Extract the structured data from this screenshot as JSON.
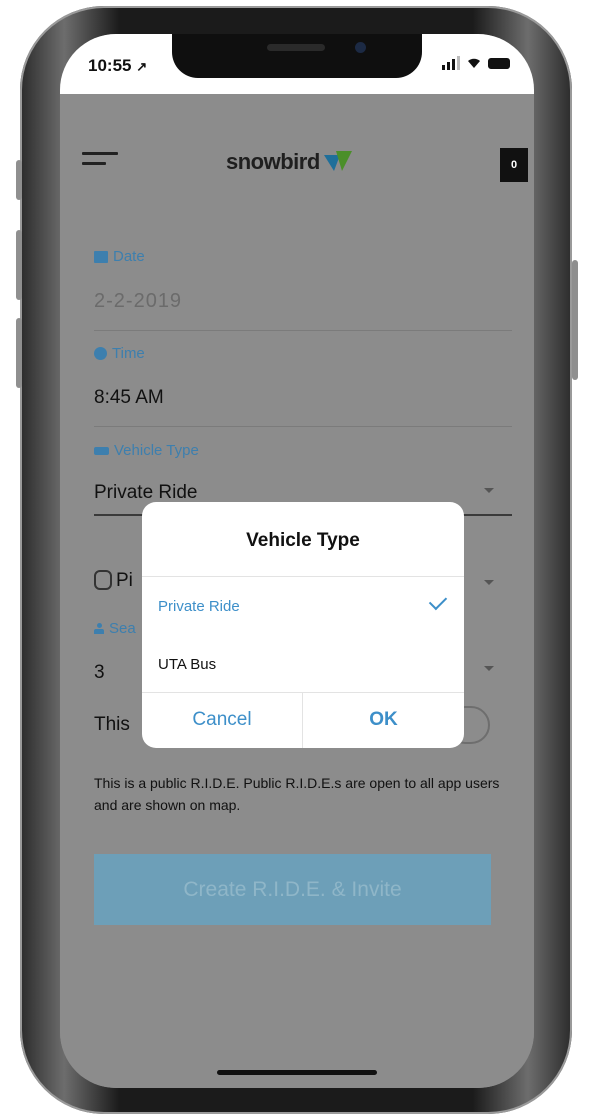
{
  "status_bar": {
    "time": "10:55",
    "location_arrow": "↗"
  },
  "header": {
    "brand": "snowbird",
    "badge_count": "0",
    "icons": [
      "menu-icon",
      "snowbird-logo-icon"
    ]
  },
  "form": {
    "date": {
      "label": "Date",
      "value": "2-2-2019"
    },
    "time": {
      "label": "Time",
      "value": "8:45 AM"
    },
    "vehicle_type": {
      "label": "Vehicle Type",
      "value": "Private Ride"
    },
    "pickup": {
      "value_partial": "Pi"
    },
    "seats": {
      "label_partial": "Sea",
      "value": "3"
    },
    "public_toggle": {
      "label_partial": "This"
    },
    "description": "This is a public R.I.D.E. Public R.I.D.E.s are open to all app users and are shown on map.",
    "submit_label": "Create R.I.D.E. & Invite"
  },
  "dialog": {
    "title": "Vehicle Type",
    "options": [
      {
        "label": "Private Ride",
        "selected": true
      },
      {
        "label": "UTA Bus",
        "selected": false
      }
    ],
    "cancel_label": "Cancel",
    "ok_label": "OK"
  },
  "colors": {
    "accent": "#3d8fc9",
    "label_blue": "#3d7fae",
    "overlay_gray": "#8c8c8c",
    "button_disabled": "#6d9fb8"
  }
}
